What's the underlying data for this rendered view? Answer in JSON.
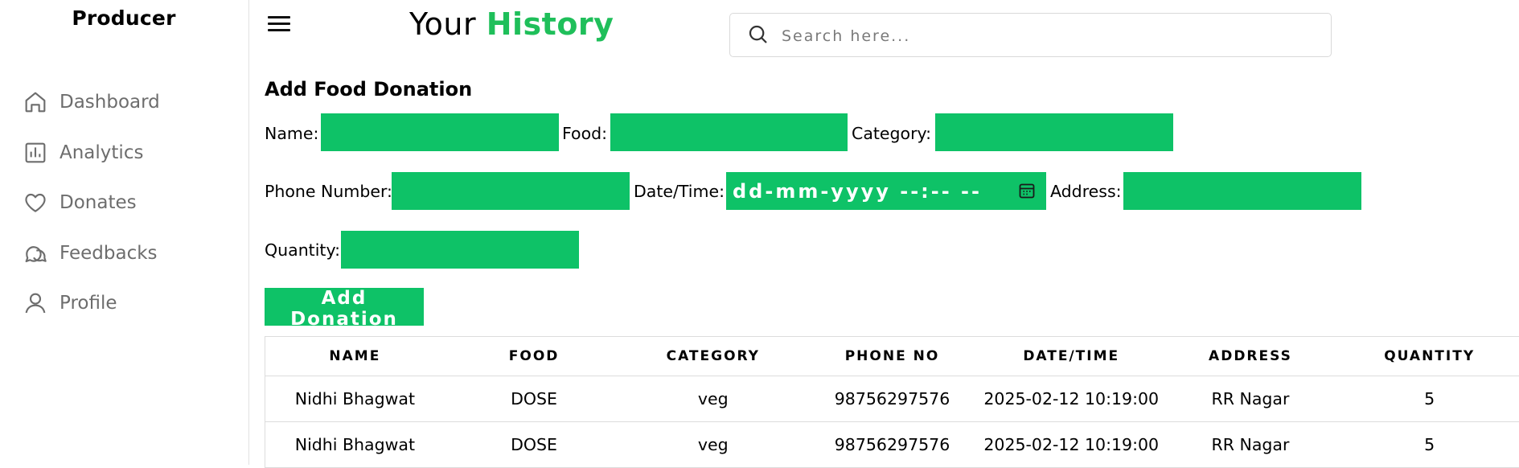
{
  "sidebar": {
    "brand": "Producer",
    "items": [
      {
        "label": "Dashboard",
        "icon": "home-icon"
      },
      {
        "label": "Analytics",
        "icon": "analytics-icon"
      },
      {
        "label": "Donates",
        "icon": "heart-icon"
      },
      {
        "label": "Feedbacks",
        "icon": "feedback-icon"
      },
      {
        "label": "Profile",
        "icon": "user-icon"
      }
    ]
  },
  "header": {
    "title_prefix": "Your",
    "title_accent": "History",
    "search_placeholder": "Search here..."
  },
  "form": {
    "title": "Add Food Donation",
    "labels": {
      "name": "Name:",
      "food": "Food:",
      "category": "Category:",
      "phone": "Phone Number:",
      "datetime": "Date/Time:",
      "address": "Address:",
      "quantity": "Quantity:"
    },
    "datetime_placeholder": "dd-mm-yyyy --:-- --",
    "submit_label": "Add Donation"
  },
  "table": {
    "headers": [
      "NAME",
      "FOOD",
      "CATEGORY",
      "PHONE NO",
      "DATE/TIME",
      "ADDRESS",
      "QUANTITY"
    ],
    "rows": [
      [
        "Nidhi Bhagwat",
        "DOSE",
        "veg",
        "98756297576",
        "2025-02-12 10:19:00",
        "RR Nagar",
        "5"
      ],
      [
        "Nidhi Bhagwat",
        "DOSE",
        "veg",
        "98756297576",
        "2025-02-12 10:19:00",
        "RR Nagar",
        "5"
      ]
    ]
  },
  "colors": {
    "accent": "#1fbf5a",
    "input_fill": "#0ec267",
    "muted_text": "#6d6d6d"
  }
}
